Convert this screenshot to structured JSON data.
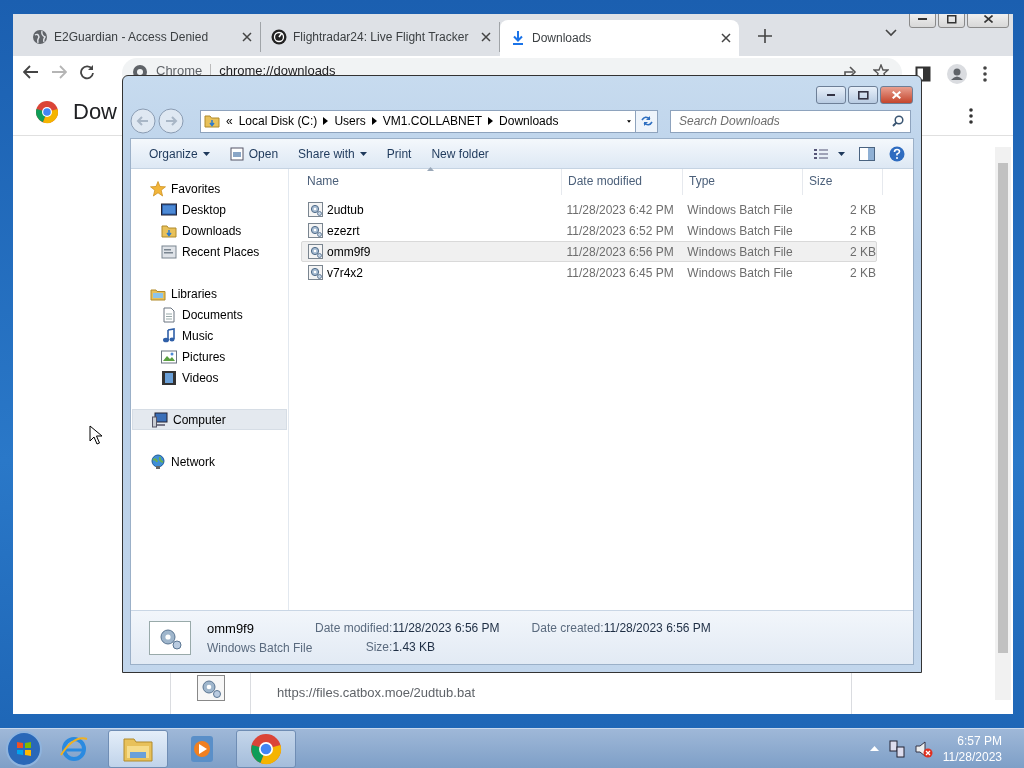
{
  "browser": {
    "tabs": [
      {
        "kind": "globe",
        "title": "E2Guardian - Access Denied",
        "selected": false
      },
      {
        "kind": "radar",
        "title": "Flightradar24: Live Flight Tracker",
        "selected": false
      },
      {
        "kind": "download",
        "title": "Downloads",
        "selected": true
      }
    ],
    "omnibox": {
      "chip": "Chrome",
      "url": "chrome://downloads"
    },
    "page": {
      "title": "Dow",
      "download_url": "https://files.catbox.moe/2udtub.bat"
    }
  },
  "explorer": {
    "breadcrumb": {
      "overflow": "«",
      "parts": [
        "Local Disk (C:)",
        "Users",
        "VM1.COLLABNET",
        "Downloads"
      ]
    },
    "search": {
      "placeholder": "Search Downloads"
    },
    "toolbar": [
      {
        "kind": "menu",
        "label": "Organize"
      },
      {
        "kind": "open",
        "label": "Open"
      },
      {
        "kind": "menu",
        "label": "Share with"
      },
      {
        "kind": "plain",
        "label": "Print"
      },
      {
        "kind": "plain",
        "label": "New folder"
      }
    ],
    "nav": [
      {
        "kind": "star",
        "label": "Favorites",
        "selected": false,
        "children": [
          {
            "kind": "desktop",
            "label": "Desktop",
            "selected": false
          },
          {
            "kind": "downloads",
            "label": "Downloads",
            "selected": false
          },
          {
            "kind": "recent",
            "label": "Recent Places",
            "selected": false
          }
        ]
      },
      {
        "kind": "library",
        "label": "Libraries",
        "selected": false,
        "children": [
          {
            "kind": "document",
            "label": "Documents",
            "selected": false
          },
          {
            "kind": "music",
            "label": "Music",
            "selected": false
          },
          {
            "kind": "pictures",
            "label": "Pictures",
            "selected": false
          },
          {
            "kind": "videos",
            "label": "Videos",
            "selected": false
          }
        ]
      },
      {
        "kind": "computer",
        "label": "Computer",
        "selected": true
      },
      {
        "kind": "network",
        "label": "Network",
        "selected": false
      }
    ],
    "columns": [
      "Name",
      "Date modified",
      "Type",
      "Size"
    ],
    "rows": [
      {
        "name": "2udtub",
        "date": "11/28/2023 6:42 PM",
        "type": "Windows Batch File",
        "size": "2 KB",
        "selected": false
      },
      {
        "name": "ezezrt",
        "date": "11/28/2023 6:52 PM",
        "type": "Windows Batch File",
        "size": "2 KB",
        "selected": false
      },
      {
        "name": "omm9f9",
        "date": "11/28/2023 6:56 PM",
        "type": "Windows Batch File",
        "size": "2 KB",
        "selected": true
      },
      {
        "name": "v7r4x2",
        "date": "11/28/2023 6:45 PM",
        "type": "Windows Batch File",
        "size": "2 KB",
        "selected": false
      }
    ],
    "details": {
      "name": "omm9f9",
      "type": "Windows Batch File",
      "fields": [
        {
          "label": "Date modified:",
          "value": "11/28/2023 6:56 PM"
        },
        {
          "label": "Date created:",
          "value": "11/28/2023 6:56 PM"
        },
        {
          "label": "Size:",
          "value": "1.43 KB"
        }
      ]
    }
  },
  "taskbar": {
    "items": [
      {
        "kind": "ie",
        "running": false,
        "active": false
      },
      {
        "kind": "explorer",
        "running": true,
        "active": true
      },
      {
        "kind": "media",
        "running": false,
        "active": false
      },
      {
        "kind": "chrome",
        "running": true,
        "active": false
      }
    ],
    "clock": {
      "time": "6:57 PM",
      "date": "11/28/2023"
    }
  }
}
